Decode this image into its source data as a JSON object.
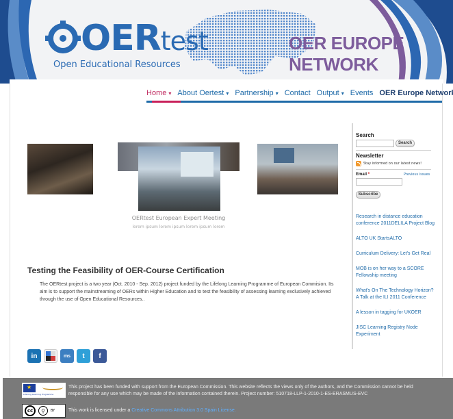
{
  "header": {
    "logo_main": "OER",
    "logo_light": "test",
    "logo_subtitle": "Open Educational Resources",
    "network_title": "OER EUROPE NETWORK"
  },
  "nav": {
    "items": [
      {
        "label": "Home",
        "caret": "▾"
      },
      {
        "label": "About Oertest",
        "caret": "▾"
      },
      {
        "label": "Partnership",
        "caret": "▾"
      },
      {
        "label": "Contact",
        "caret": ""
      },
      {
        "label": "Output",
        "caret": "▾"
      },
      {
        "label": "Events",
        "caret": ""
      },
      {
        "label": "OER Europe Network",
        "caret": "▾"
      }
    ]
  },
  "gallery": {
    "caption": "OERtest European Expert Meeting",
    "subcaption": "lorem ipsum lorem ipsum lorem ipsum lorem"
  },
  "article": {
    "title": "Testing the Feasibility of OER-Course Certification",
    "body": "The OERtest project is a two year (Oct. 2010 - Sep. 2012) project funded by the Lifelong Learning Programme of European Commision. Its aim is to support the mainstreaming of OERs within Higher Education and to test the feasibility of assessing learning exclusively achieved through the use of Open Educational Resources.."
  },
  "sidebar": {
    "search_label": "Search",
    "search_button": "Search",
    "newsletter_label": "Newsletter",
    "rss_text": "Stay informed on our latest news!",
    "email_label": "Email",
    "email_required": "*",
    "previous_issues": "Previous issues",
    "subscribe_button": "Subscribe",
    "links": [
      "Research in distance education conference 2011DELILA Project Blog",
      "ALTO UK StartsALTO",
      "Curriculum Delivery: Let's Get Real",
      "MOB is on her way to a SCORE Fellowship meeting",
      "What's On The Technology Horizon? A Talk at the ILI 2011 Conference",
      "A lesson in tagging for UKOER",
      "JISC Learning Registry Node Experiment"
    ]
  },
  "social": {
    "icons": [
      "linkedin-icon",
      "delicious-icon",
      "myspace-icon",
      "twitter-icon",
      "facebook-icon"
    ],
    "glyphs": [
      "in",
      "✦",
      "ms",
      "t",
      "f"
    ]
  },
  "footer": {
    "eu_caption": "Lifelong Learning Programme",
    "funding_text": "This project has been funded with support from the European Commission. This website reflects the views only of the authors, and the Commission cannot be held responsible for any use which may be made of the information contained therein. Project number: 510718-LLP-1-2010-1-ES-ERASMUS-EVC",
    "cc_label": "BY",
    "license_prefix": "This work is licensed under a ",
    "license_link": "Creative Commons Attribution 3.0 Spain License."
  },
  "colors": {
    "brand_blue": "#2a6ab3",
    "nav_active": "#c02a60",
    "network_purple": "#7d5c9c",
    "footer_gray": "#7a7a7a"
  }
}
